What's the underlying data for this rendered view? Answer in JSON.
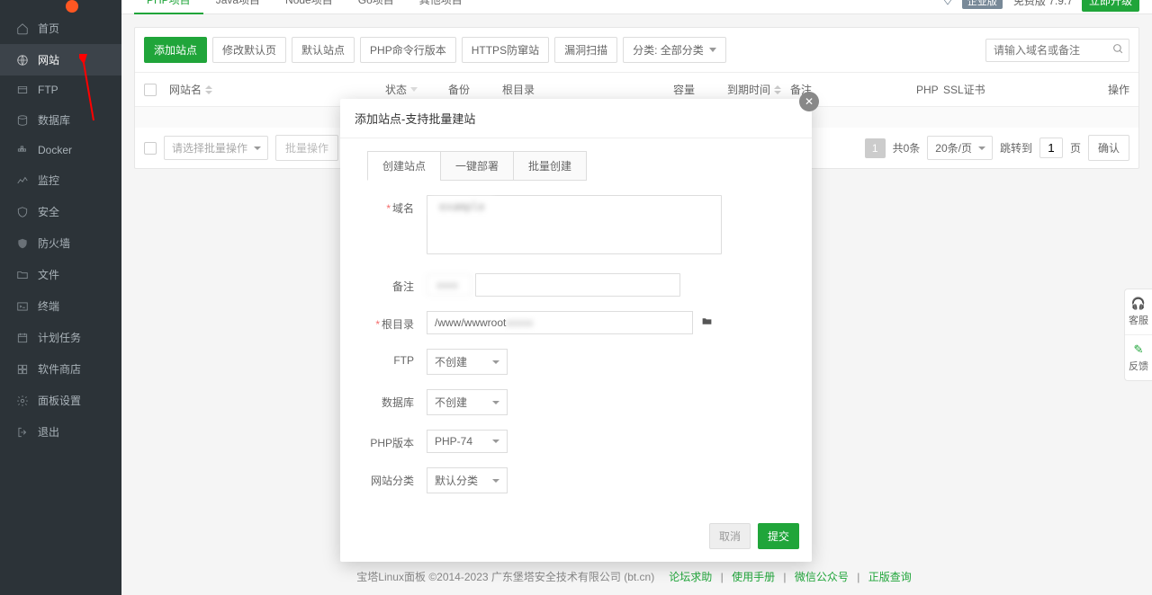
{
  "sidebar": {
    "items": [
      {
        "label": "首页",
        "icon": "home-icon"
      },
      {
        "label": "网站",
        "icon": "globe-icon",
        "active": true
      },
      {
        "label": "FTP",
        "icon": "ftp-icon"
      },
      {
        "label": "数据库",
        "icon": "database-icon"
      },
      {
        "label": "Docker",
        "icon": "docker-icon"
      },
      {
        "label": "监控",
        "icon": "monitor-icon"
      },
      {
        "label": "安全",
        "icon": "shield-icon"
      },
      {
        "label": "防火墙",
        "icon": "firewall-icon"
      },
      {
        "label": "文件",
        "icon": "folder-icon"
      },
      {
        "label": "终端",
        "icon": "terminal-icon"
      },
      {
        "label": "计划任务",
        "icon": "cron-icon"
      },
      {
        "label": "软件商店",
        "icon": "store-icon"
      },
      {
        "label": "面板设置",
        "icon": "settings-icon"
      },
      {
        "label": "退出",
        "icon": "logout-icon"
      }
    ]
  },
  "tabs": {
    "items": [
      {
        "label": "PHP项目",
        "active": true
      },
      {
        "label": "Java项目"
      },
      {
        "label": "Node项目"
      },
      {
        "label": "Go项目"
      },
      {
        "label": "其他项目"
      }
    ],
    "enterprise": "企业版",
    "free_label": "免费版",
    "version": "7.9.7",
    "upgrade": "立即升级"
  },
  "toolbar": {
    "add_site": "添加站点",
    "edit_default": "修改默认页",
    "default_site": "默认站点",
    "php_cli": "PHP命令行版本",
    "https_anti": "HTTPS防窜站",
    "vuln_scan": "漏洞扫描",
    "category": "分类: 全部分类",
    "search_placeholder": "请输入域名或备注"
  },
  "table": {
    "th_site": "网站名",
    "th_status": "状态",
    "th_backup": "备份",
    "th_root": "根目录",
    "th_capacity": "容量",
    "th_expire": "到期时间",
    "th_note": "备注",
    "th_php": "PHP",
    "th_ssl": "SSL证书",
    "th_op": "操作"
  },
  "batch": {
    "select_placeholder": "请选择批量操作",
    "batch_btn": "批量操作"
  },
  "pager": {
    "current": "1",
    "total": "共0条",
    "page_size": "20条/页",
    "jump_label": "跳转到",
    "jump_value": "1",
    "page_word": "页",
    "confirm": "确认"
  },
  "modal": {
    "title": "添加站点-支持批量建站",
    "tabs": [
      {
        "label": "创建站点",
        "active": true
      },
      {
        "label": "一键部署"
      },
      {
        "label": "批量创建"
      }
    ],
    "fields": {
      "domain_label": "域名",
      "domain_masked": "example",
      "remark_label": "备注",
      "remark_masked": "xxxx",
      "root_label": "根目录",
      "root_value": "/www/wwwroot",
      "root_masked": "xxxxx",
      "ftp_label": "FTP",
      "ftp_value": "不创建",
      "db_label": "数据库",
      "db_value": "不创建",
      "php_label": "PHP版本",
      "php_value": "PHP-74",
      "cat_label": "网站分类",
      "cat_value": "默认分类"
    },
    "cancel": "取消",
    "submit": "提交"
  },
  "float": {
    "service": "客服",
    "feedback": "反馈"
  },
  "footer": {
    "text": "宝塔Linux面板 ©2014-2023 广东堡塔安全技术有限公司 (bt.cn)",
    "links": [
      "论坛求助",
      "使用手册",
      "微信公众号",
      "正版查询"
    ]
  }
}
